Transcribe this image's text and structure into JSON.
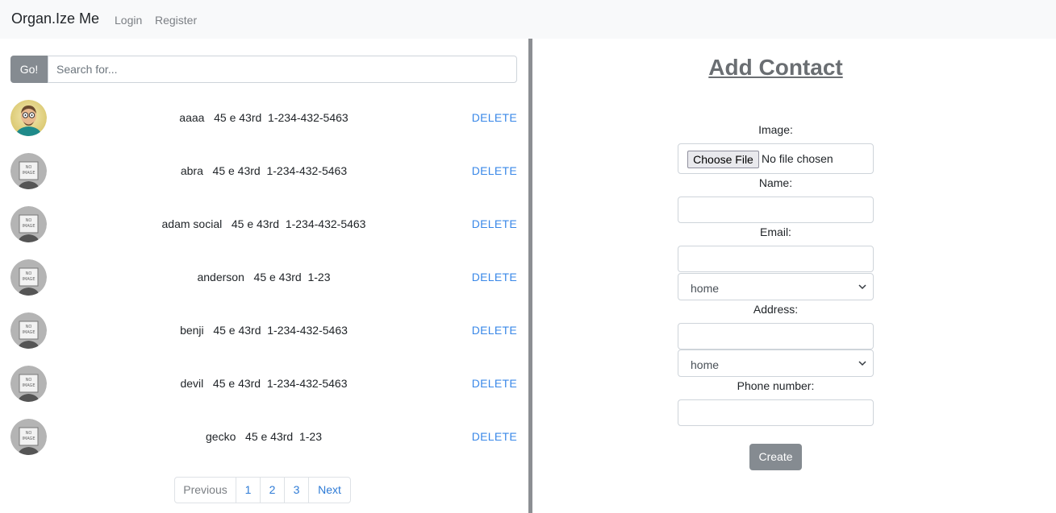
{
  "navbar": {
    "brand": "Organ.Ize Me",
    "login": "Login",
    "register": "Register"
  },
  "search": {
    "button_label": "Go!",
    "placeholder": "Search for..."
  },
  "contacts": [
    {
      "info": "aaaa   45 e 43rd  1-234-432-5463",
      "delete_label": "DELETE",
      "avatar": "cartoon-avatar"
    },
    {
      "info": "abra   45 e 43rd  1-234-432-5463",
      "delete_label": "DELETE",
      "avatar": "no-image"
    },
    {
      "info": "adam social   45 e 43rd  1-234-432-5463",
      "delete_label": "DELETE",
      "avatar": "no-image"
    },
    {
      "info": "anderson   45 e 43rd  1-23",
      "delete_label": "DELETE",
      "avatar": "no-image"
    },
    {
      "info": "benji   45 e 43rd  1-234-432-5463",
      "delete_label": "DELETE",
      "avatar": "no-image"
    },
    {
      "info": "devil   45 e 43rd  1-234-432-5463",
      "delete_label": "DELETE",
      "avatar": "no-image"
    },
    {
      "info": "gecko   45 e 43rd  1-23",
      "delete_label": "DELETE",
      "avatar": "no-image"
    }
  ],
  "pagination": {
    "previous": "Previous",
    "pages": [
      "1",
      "2",
      "3"
    ],
    "next": "Next"
  },
  "form": {
    "title": "Add Contact",
    "image_label": "Image:",
    "file_button": "Choose File",
    "file_status": "No file chosen",
    "name_label": "Name:",
    "email_label": "Email:",
    "email_type": "home",
    "address_label": "Address:",
    "address_type": "home",
    "phone_label": "Phone number:",
    "create_label": "Create"
  }
}
